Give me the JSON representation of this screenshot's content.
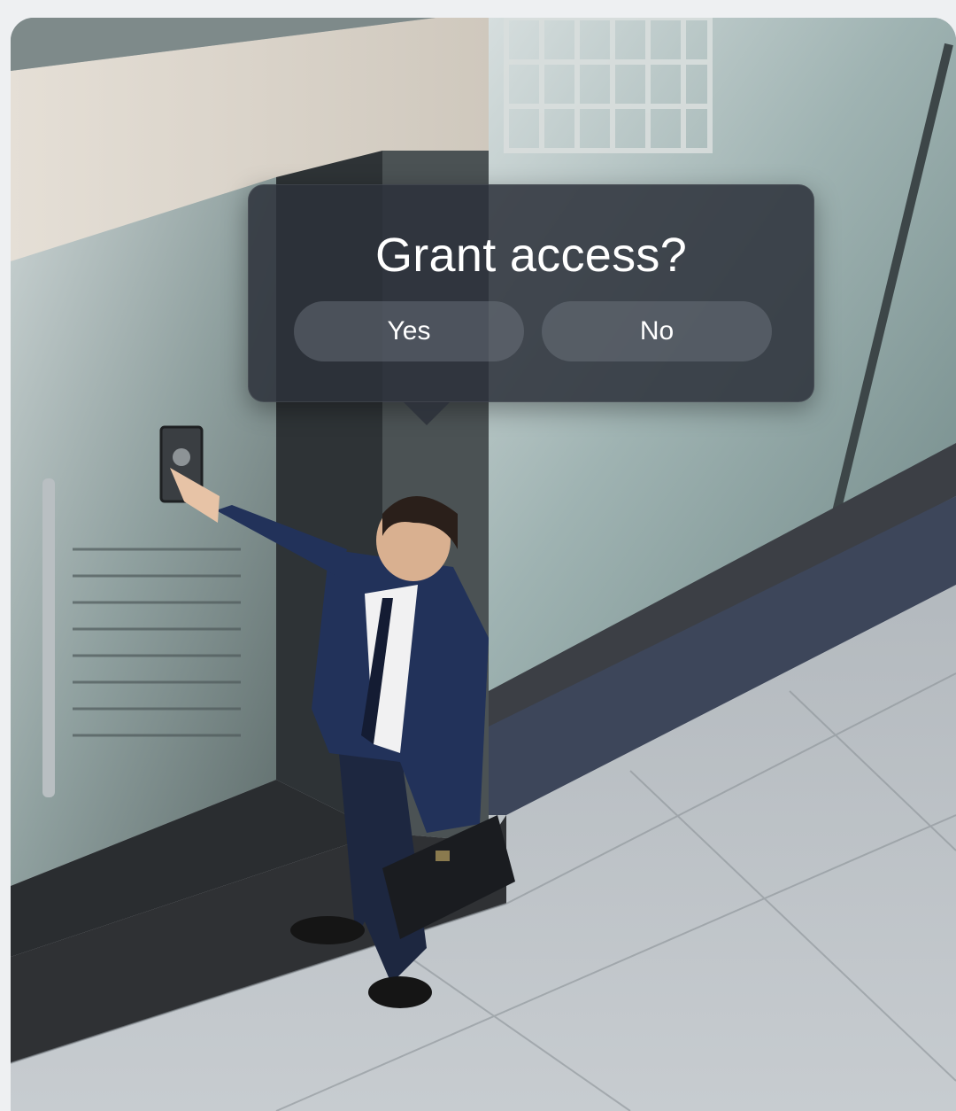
{
  "dialog": {
    "title": "Grant access?",
    "yes_label": "Yes",
    "no_label": "No"
  },
  "scene": {
    "description_icon": "photo-businessman-at-door-keypad"
  },
  "colors": {
    "dialog_bg": "#2c313a",
    "button_bg": "#787e88",
    "text": "#ffffff",
    "page_bg": "#eef0f2"
  }
}
